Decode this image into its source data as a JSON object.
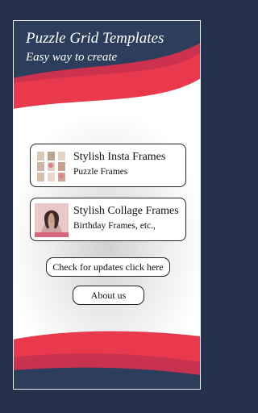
{
  "header": {
    "title": "Puzzle Grid Templates",
    "subtitle": "Easy way to create"
  },
  "cards": [
    {
      "title": "Stylish Insta Frames",
      "subtitle": "Puzzle Frames",
      "thumb": "puzzle-grid-thumbnail"
    },
    {
      "title": "Stylish Collage Frames",
      "subtitle": "Birthday Frames, etc.,",
      "thumb": "portrait-photo-thumbnail"
    }
  ],
  "buttons": {
    "updates": "Check for updates click here",
    "about": "About us"
  },
  "colors": {
    "navy": "#23314d",
    "red": "#e8394d",
    "white": "#ffffff"
  }
}
